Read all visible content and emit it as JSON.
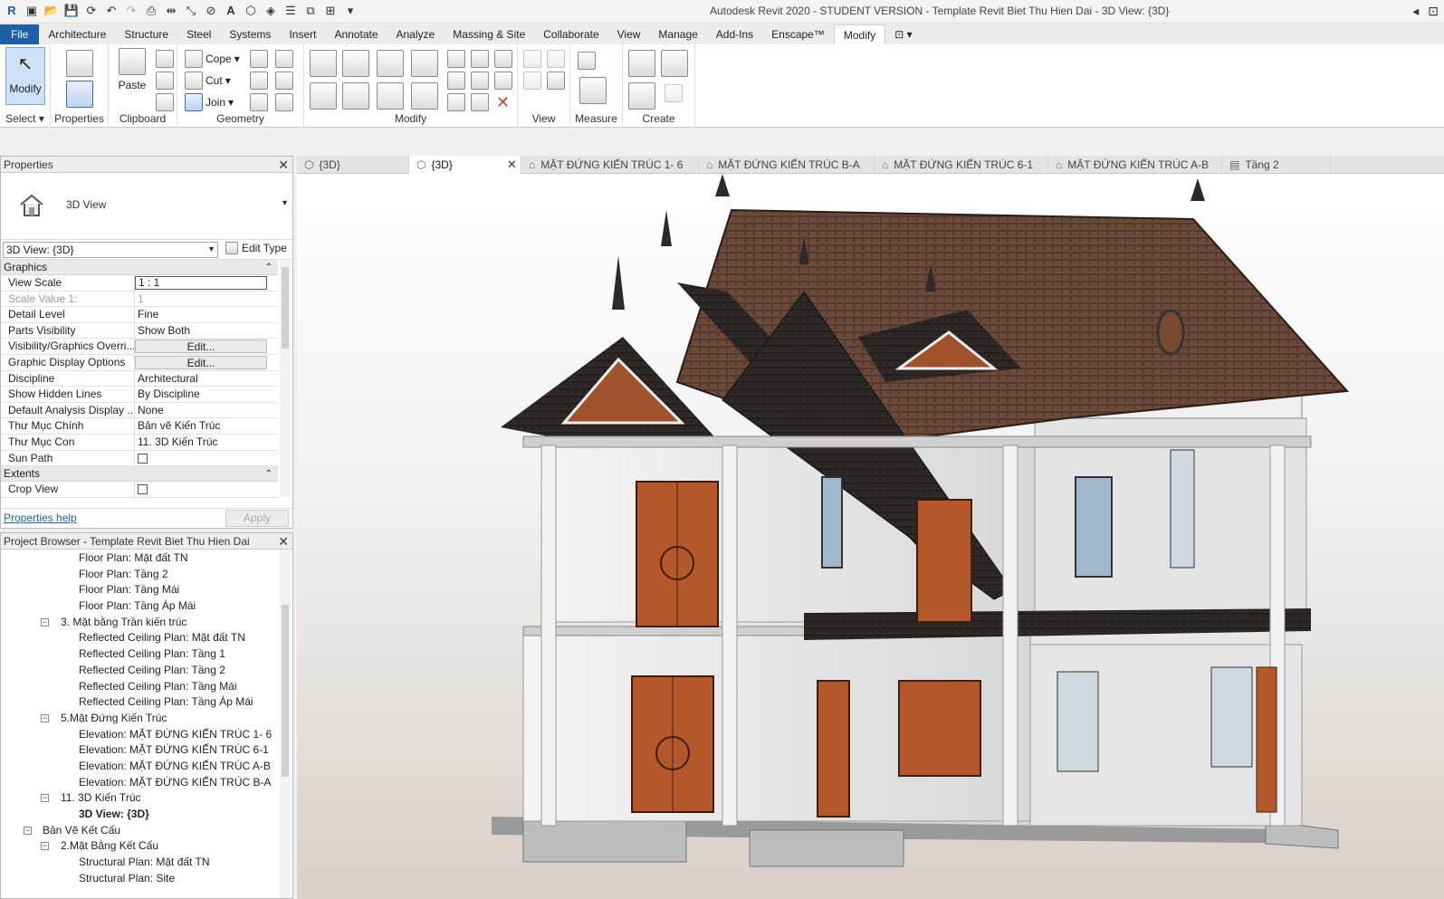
{
  "app": {
    "title": "Autodesk Revit 2020 - STUDENT VERSION - Template Revit Biet Thu Hien Dai - 3D View: {3D}"
  },
  "ribbon_tabs": [
    "File",
    "Architecture",
    "Structure",
    "Steel",
    "Systems",
    "Insert",
    "Annotate",
    "Analyze",
    "Massing & Site",
    "Collaborate",
    "View",
    "Manage",
    "Add-Ins",
    "Enscape™",
    "Modify"
  ],
  "ribbon": {
    "select": {
      "modify_label": "Modify",
      "panel_label": "Select"
    },
    "properties": {
      "label": "Properties"
    },
    "clipboard": {
      "paste_label": "Paste",
      "panel_label": "Clipboard"
    },
    "geometry": {
      "cope_label": "Cope",
      "cut_label": "Cut",
      "join_label": "Join",
      "panel_label": "Geometry"
    },
    "modify": {
      "panel_label": "Modify"
    },
    "view": {
      "panel_label": "View"
    },
    "measure": {
      "panel_label": "Measure"
    },
    "create": {
      "panel_label": "Create"
    }
  },
  "properties": {
    "title": "Properties",
    "type_name": "3D View",
    "instance_selector": "3D View: {3D}",
    "edit_type": "Edit Type",
    "groups": {
      "graphics": "Graphics",
      "extents": "Extents"
    },
    "rows": [
      {
        "key": "View Scale",
        "value": "1 : 1"
      },
      {
        "key": "Scale Value    1:",
        "value": "1"
      },
      {
        "key": "Detail Level",
        "value": "Fine"
      },
      {
        "key": "Parts Visibility",
        "value": "Show Both"
      },
      {
        "key": "Visibility/Graphics Overri...",
        "value": "Edit..."
      },
      {
        "key": "Graphic Display Options",
        "value": "Edit..."
      },
      {
        "key": "Discipline",
        "value": "Architectural"
      },
      {
        "key": "Show Hidden Lines",
        "value": "By Discipline"
      },
      {
        "key": "Default Analysis Display ...",
        "value": "None"
      },
      {
        "key": "Thư Mục Chính",
        "value": "Bản vẽ Kiến Trúc"
      },
      {
        "key": "Thư Mục Con",
        "value": "11. 3D Kiến Trúc"
      },
      {
        "key": "Sun Path",
        "value": ""
      },
      {
        "key": "Crop View",
        "value": ""
      }
    ],
    "help_link": "Properties help",
    "apply_label": "Apply"
  },
  "browser": {
    "title": "Project Browser - Template Revit Biet Thu Hien Dai",
    "nodes": [
      {
        "label": "Floor Plan: Mặt đất TN"
      },
      {
        "label": "Floor Plan: Tầng 2"
      },
      {
        "label": "Floor Plan: Tầng Mái"
      },
      {
        "label": "Floor Plan: Tầng Áp Mái"
      },
      {
        "label": "3. Mặt bằng Trần kiến trúc",
        "toggle": "−"
      },
      {
        "label": "Reflected Ceiling Plan: Mặt đất TN"
      },
      {
        "label": "Reflected Ceiling Plan: Tầng 1"
      },
      {
        "label": "Reflected Ceiling Plan: Tầng 2"
      },
      {
        "label": "Reflected Ceiling Plan: Tầng Mái"
      },
      {
        "label": "Reflected Ceiling Plan: Tầng Áp Mái"
      },
      {
        "label": "5.Mặt Đứng Kiến Trúc",
        "toggle": "−"
      },
      {
        "label": "Elevation: MẶT ĐỨNG KIẾN TRÚC 1- 6"
      },
      {
        "label": "Elevation: MẶT ĐỨNG KIẾN TRÚC 6-1"
      },
      {
        "label": "Elevation: MẶT ĐỨNG KIẾN TRÚC A-B"
      },
      {
        "label": "Elevation: MẶT ĐỨNG KIẾN TRÚC B-A"
      },
      {
        "label": "11. 3D Kiến Trúc",
        "toggle": "−"
      },
      {
        "label": "3D View: {3D}"
      },
      {
        "label": "Bản Vẽ Kết Cấu",
        "toggle": "−"
      },
      {
        "label": "2.Mặt Bằng Kết Cấu",
        "toggle": "−"
      },
      {
        "label": "Structural Plan: Mặt đất TN"
      },
      {
        "label": "Structural Plan: Site"
      }
    ]
  },
  "view_tabs": [
    {
      "label": "{3D}"
    },
    {
      "label": "{3D}"
    },
    {
      "label": "MẶT ĐỨNG KIẾN TRÚC 1- 6"
    },
    {
      "label": "MẶT ĐỨNG KIẾN TRÚC B-A"
    },
    {
      "label": "MẶT ĐỨNG KIẾN TRÚC 6-1"
    },
    {
      "label": "MẶT ĐỨNG KIẾN TRÚC A-B"
    },
    {
      "label": "Tầng 2"
    }
  ],
  "colors": {
    "file_tab": "#1d5fa8",
    "roof": "#6b4a3a",
    "wall": "#ececec",
    "door": "#b4582c"
  }
}
